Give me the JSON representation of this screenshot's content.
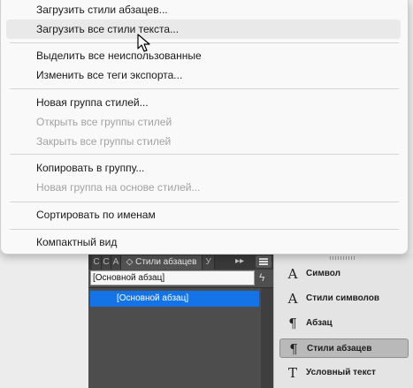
{
  "menu": {
    "items": [
      {
        "label": "Загрузить стили абзацев...",
        "disabled": false
      },
      {
        "label": "Загрузить все стили текста...",
        "disabled": false,
        "hover": true
      },
      {
        "label": "Выделить все неиспользованные",
        "disabled": false
      },
      {
        "label": "Изменить все теги экспорта...",
        "disabled": false
      },
      {
        "label": "Новая группа стилей...",
        "disabled": false
      },
      {
        "label": "Открыть все группы стилей",
        "disabled": true
      },
      {
        "label": "Закрыть все группы стилей",
        "disabled": true
      },
      {
        "label": "Копировать в группу...",
        "disabled": false
      },
      {
        "label": "Новая группа на основе стилей...",
        "disabled": true
      },
      {
        "label": "Сортировать по именам",
        "disabled": false
      },
      {
        "label": "Компактный вид",
        "disabled": false
      }
    ]
  },
  "styles_panel": {
    "tabs": [
      "С",
      "С",
      "А",
      "Стили абзацев",
      "У"
    ],
    "active_tab": "Стили абзацев",
    "current_style": "[Основной абзац]",
    "list": [
      "[Основной абзац]"
    ]
  },
  "dock": {
    "items": [
      {
        "label": "Символ",
        "icon": "character-icon"
      },
      {
        "label": "Стили символов",
        "icon": "character-styles-icon"
      },
      {
        "label": "Абзац",
        "icon": "paragraph-icon"
      },
      {
        "label": "Стили абзацев",
        "icon": "paragraph-styles-icon",
        "active": true
      },
      {
        "label": "Условный текст",
        "icon": "conditional-text-icon"
      }
    ]
  },
  "colors": {
    "selection": "#1473e6",
    "panel_dark": "#4d4d4d",
    "menu_bg": "#f9f9f9",
    "disabled_text": "#a2a2a2"
  }
}
